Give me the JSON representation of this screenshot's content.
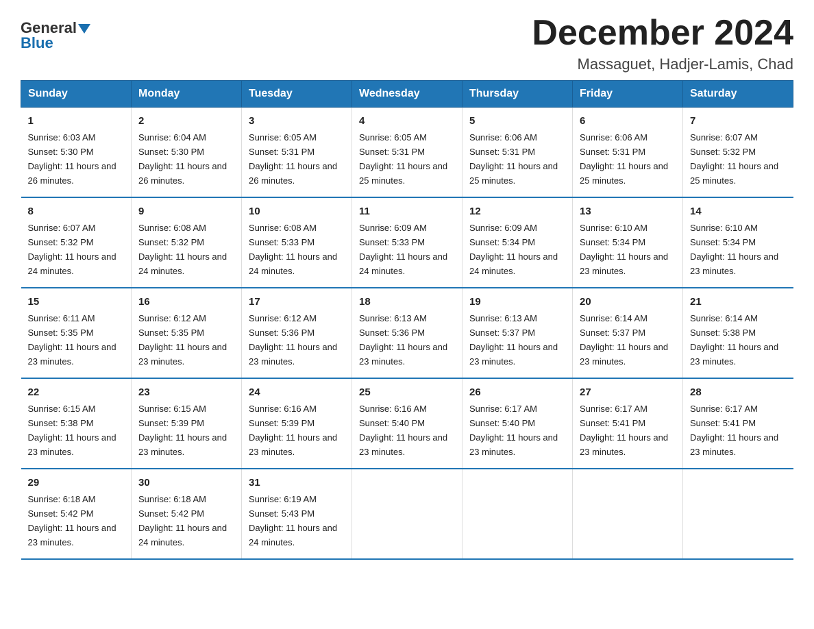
{
  "header": {
    "logo_general": "General",
    "logo_blue": "Blue",
    "month_title": "December 2024",
    "location": "Massaguet, Hadjer-Lamis, Chad"
  },
  "days_of_week": [
    "Sunday",
    "Monday",
    "Tuesday",
    "Wednesday",
    "Thursday",
    "Friday",
    "Saturday"
  ],
  "weeks": [
    [
      {
        "day": "1",
        "sunrise": "6:03 AM",
        "sunset": "5:30 PM",
        "daylight": "11 hours and 26 minutes."
      },
      {
        "day": "2",
        "sunrise": "6:04 AM",
        "sunset": "5:30 PM",
        "daylight": "11 hours and 26 minutes."
      },
      {
        "day": "3",
        "sunrise": "6:05 AM",
        "sunset": "5:31 PM",
        "daylight": "11 hours and 26 minutes."
      },
      {
        "day": "4",
        "sunrise": "6:05 AM",
        "sunset": "5:31 PM",
        "daylight": "11 hours and 25 minutes."
      },
      {
        "day": "5",
        "sunrise": "6:06 AM",
        "sunset": "5:31 PM",
        "daylight": "11 hours and 25 minutes."
      },
      {
        "day": "6",
        "sunrise": "6:06 AM",
        "sunset": "5:31 PM",
        "daylight": "11 hours and 25 minutes."
      },
      {
        "day": "7",
        "sunrise": "6:07 AM",
        "sunset": "5:32 PM",
        "daylight": "11 hours and 25 minutes."
      }
    ],
    [
      {
        "day": "8",
        "sunrise": "6:07 AM",
        "sunset": "5:32 PM",
        "daylight": "11 hours and 24 minutes."
      },
      {
        "day": "9",
        "sunrise": "6:08 AM",
        "sunset": "5:32 PM",
        "daylight": "11 hours and 24 minutes."
      },
      {
        "day": "10",
        "sunrise": "6:08 AM",
        "sunset": "5:33 PM",
        "daylight": "11 hours and 24 minutes."
      },
      {
        "day": "11",
        "sunrise": "6:09 AM",
        "sunset": "5:33 PM",
        "daylight": "11 hours and 24 minutes."
      },
      {
        "day": "12",
        "sunrise": "6:09 AM",
        "sunset": "5:34 PM",
        "daylight": "11 hours and 24 minutes."
      },
      {
        "day": "13",
        "sunrise": "6:10 AM",
        "sunset": "5:34 PM",
        "daylight": "11 hours and 23 minutes."
      },
      {
        "day": "14",
        "sunrise": "6:10 AM",
        "sunset": "5:34 PM",
        "daylight": "11 hours and 23 minutes."
      }
    ],
    [
      {
        "day": "15",
        "sunrise": "6:11 AM",
        "sunset": "5:35 PM",
        "daylight": "11 hours and 23 minutes."
      },
      {
        "day": "16",
        "sunrise": "6:12 AM",
        "sunset": "5:35 PM",
        "daylight": "11 hours and 23 minutes."
      },
      {
        "day": "17",
        "sunrise": "6:12 AM",
        "sunset": "5:36 PM",
        "daylight": "11 hours and 23 minutes."
      },
      {
        "day": "18",
        "sunrise": "6:13 AM",
        "sunset": "5:36 PM",
        "daylight": "11 hours and 23 minutes."
      },
      {
        "day": "19",
        "sunrise": "6:13 AM",
        "sunset": "5:37 PM",
        "daylight": "11 hours and 23 minutes."
      },
      {
        "day": "20",
        "sunrise": "6:14 AM",
        "sunset": "5:37 PM",
        "daylight": "11 hours and 23 minutes."
      },
      {
        "day": "21",
        "sunrise": "6:14 AM",
        "sunset": "5:38 PM",
        "daylight": "11 hours and 23 minutes."
      }
    ],
    [
      {
        "day": "22",
        "sunrise": "6:15 AM",
        "sunset": "5:38 PM",
        "daylight": "11 hours and 23 minutes."
      },
      {
        "day": "23",
        "sunrise": "6:15 AM",
        "sunset": "5:39 PM",
        "daylight": "11 hours and 23 minutes."
      },
      {
        "day": "24",
        "sunrise": "6:16 AM",
        "sunset": "5:39 PM",
        "daylight": "11 hours and 23 minutes."
      },
      {
        "day": "25",
        "sunrise": "6:16 AM",
        "sunset": "5:40 PM",
        "daylight": "11 hours and 23 minutes."
      },
      {
        "day": "26",
        "sunrise": "6:17 AM",
        "sunset": "5:40 PM",
        "daylight": "11 hours and 23 minutes."
      },
      {
        "day": "27",
        "sunrise": "6:17 AM",
        "sunset": "5:41 PM",
        "daylight": "11 hours and 23 minutes."
      },
      {
        "day": "28",
        "sunrise": "6:17 AM",
        "sunset": "5:41 PM",
        "daylight": "11 hours and 23 minutes."
      }
    ],
    [
      {
        "day": "29",
        "sunrise": "6:18 AM",
        "sunset": "5:42 PM",
        "daylight": "11 hours and 23 minutes."
      },
      {
        "day": "30",
        "sunrise": "6:18 AM",
        "sunset": "5:42 PM",
        "daylight": "11 hours and 24 minutes."
      },
      {
        "day": "31",
        "sunrise": "6:19 AM",
        "sunset": "5:43 PM",
        "daylight": "11 hours and 24 minutes."
      },
      {
        "day": "",
        "sunrise": "",
        "sunset": "",
        "daylight": ""
      },
      {
        "day": "",
        "sunrise": "",
        "sunset": "",
        "daylight": ""
      },
      {
        "day": "",
        "sunrise": "",
        "sunset": "",
        "daylight": ""
      },
      {
        "day": "",
        "sunrise": "",
        "sunset": "",
        "daylight": ""
      }
    ]
  ],
  "labels": {
    "sunrise": "Sunrise:",
    "sunset": "Sunset:",
    "daylight": "Daylight:"
  }
}
